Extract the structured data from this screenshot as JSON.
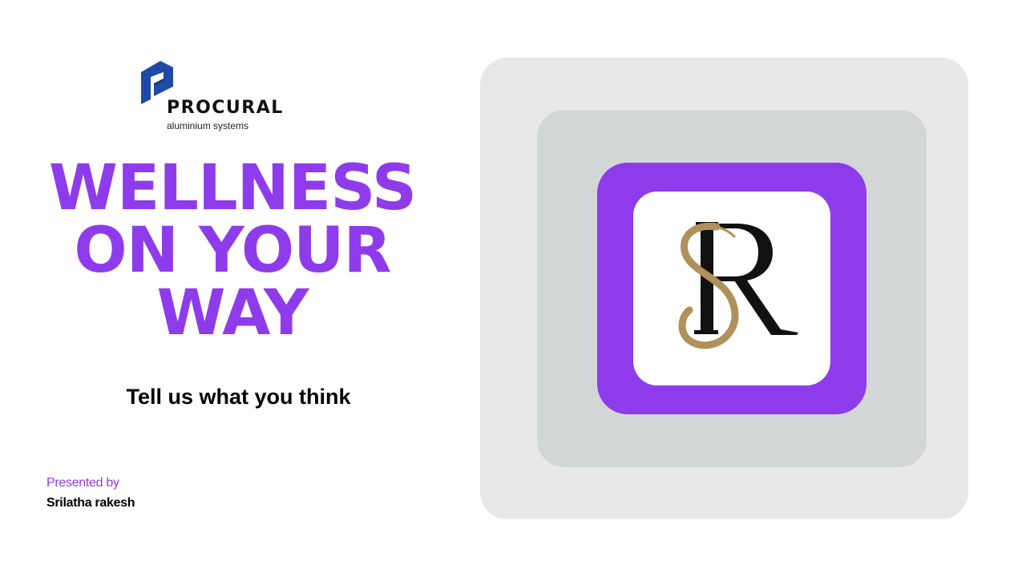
{
  "brand": {
    "name": "PROCURAL",
    "tagline": "aluminium systems",
    "mark_icon": "procural-logo-mark",
    "color": "#1f4aa8"
  },
  "headline": {
    "lines": [
      "WELLNESS",
      "ON YOUR",
      "WAY"
    ],
    "color": "#8e3ceb"
  },
  "subheading": "Tell us what you think",
  "presenter": {
    "label": "Presented by",
    "name": "Srilatha rakesh"
  },
  "monogram": {
    "letters": "SR",
    "icon": "sr-monogram-logo",
    "colors": {
      "s": "#b0915a",
      "r": "#111111"
    }
  },
  "colors": {
    "accent": "#8e3ceb",
    "frame_outer": "#e8e8e8",
    "frame_middle": "#d3d6d7"
  }
}
